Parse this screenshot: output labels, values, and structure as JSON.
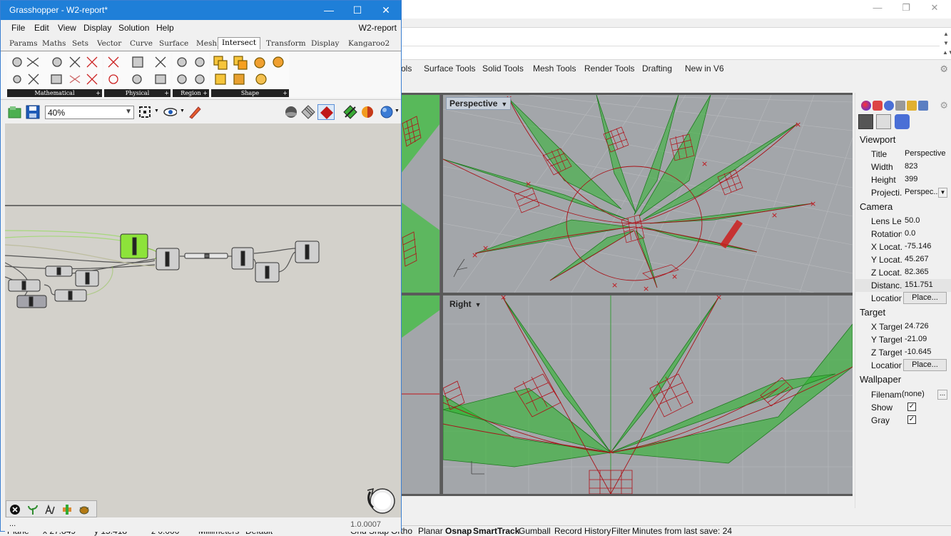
{
  "gh": {
    "title": "Grasshopper - W2-report*",
    "doc_name": "W2-report",
    "menu": [
      "File",
      "Edit",
      "View",
      "Display",
      "Solution",
      "Help"
    ],
    "tabs": [
      "Params",
      "Maths",
      "Sets",
      "Vector",
      "Curve",
      "Surface",
      "Mesh",
      "Intersect",
      "Transform",
      "Display",
      "Kangaroo2"
    ],
    "active_tab": "Intersect",
    "groups": [
      "Mathematical",
      "Physical",
      "Region",
      "Shape"
    ],
    "zoom": "40%",
    "version": "1.0.0007",
    "bottom_dots": "..."
  },
  "rhino": {
    "tabs": [
      "ols",
      "Surface Tools",
      "Solid Tools",
      "Mesh Tools",
      "Render Tools",
      "Drafting",
      "New in V6"
    ],
    "viewports": {
      "perspective": "Perspective",
      "right": "Right"
    },
    "properties": {
      "viewport_header": "Viewport",
      "viewport": [
        {
          "label": "Title",
          "value": "Perspective"
        },
        {
          "label": "Width",
          "value": "823"
        },
        {
          "label": "Height",
          "value": "399"
        },
        {
          "label": "Projecti...",
          "value": "Perspec..."
        }
      ],
      "camera_header": "Camera",
      "camera": [
        {
          "label": "Lens Le...",
          "value": "50.0"
        },
        {
          "label": "Rotation",
          "value": "0.0"
        },
        {
          "label": "X Locat...",
          "value": "-75.146"
        },
        {
          "label": "Y Locat...",
          "value": "45.267"
        },
        {
          "label": "Z Locat...",
          "value": "82.365"
        },
        {
          "label": "Distanc...",
          "value": "151.751"
        },
        {
          "label": "Location",
          "value": "Place..."
        }
      ],
      "target_header": "Target",
      "target": [
        {
          "label": "X Target",
          "value": "24.726"
        },
        {
          "label": "Y Target",
          "value": "-21.09"
        },
        {
          "label": "Z Target",
          "value": "-10.645"
        },
        {
          "label": "Location",
          "value": "Place..."
        }
      ],
      "wallpaper_header": "Wallpaper",
      "wallpaper": [
        {
          "label": "Filename",
          "value": "(none)"
        },
        {
          "label": "Show",
          "value": "✓"
        },
        {
          "label": "Gray",
          "value": "✓"
        }
      ],
      "filename_button": "..."
    },
    "status": {
      "plane": "Plane",
      "x": "x 27.849",
      "y": "y 15.418",
      "z": "z 0.000",
      "units": "Millimeters",
      "layer": "Default",
      "grid_snap": "Grid Snap",
      "ortho": "Ortho",
      "planar": "Planar",
      "osnap": "Osnap",
      "smarttrack": "SmartTrack",
      "gumball": "Gumball",
      "record_history": "Record History",
      "filter": "Filter",
      "save_info": "Minutes from last save: 24"
    }
  },
  "colors": {
    "gh_title": "#1f7fd8",
    "canvas": "#d3d1cb",
    "surface_green": "#3fbf3f",
    "curve_red": "#c0141a",
    "selected_component": "#8de33a"
  }
}
